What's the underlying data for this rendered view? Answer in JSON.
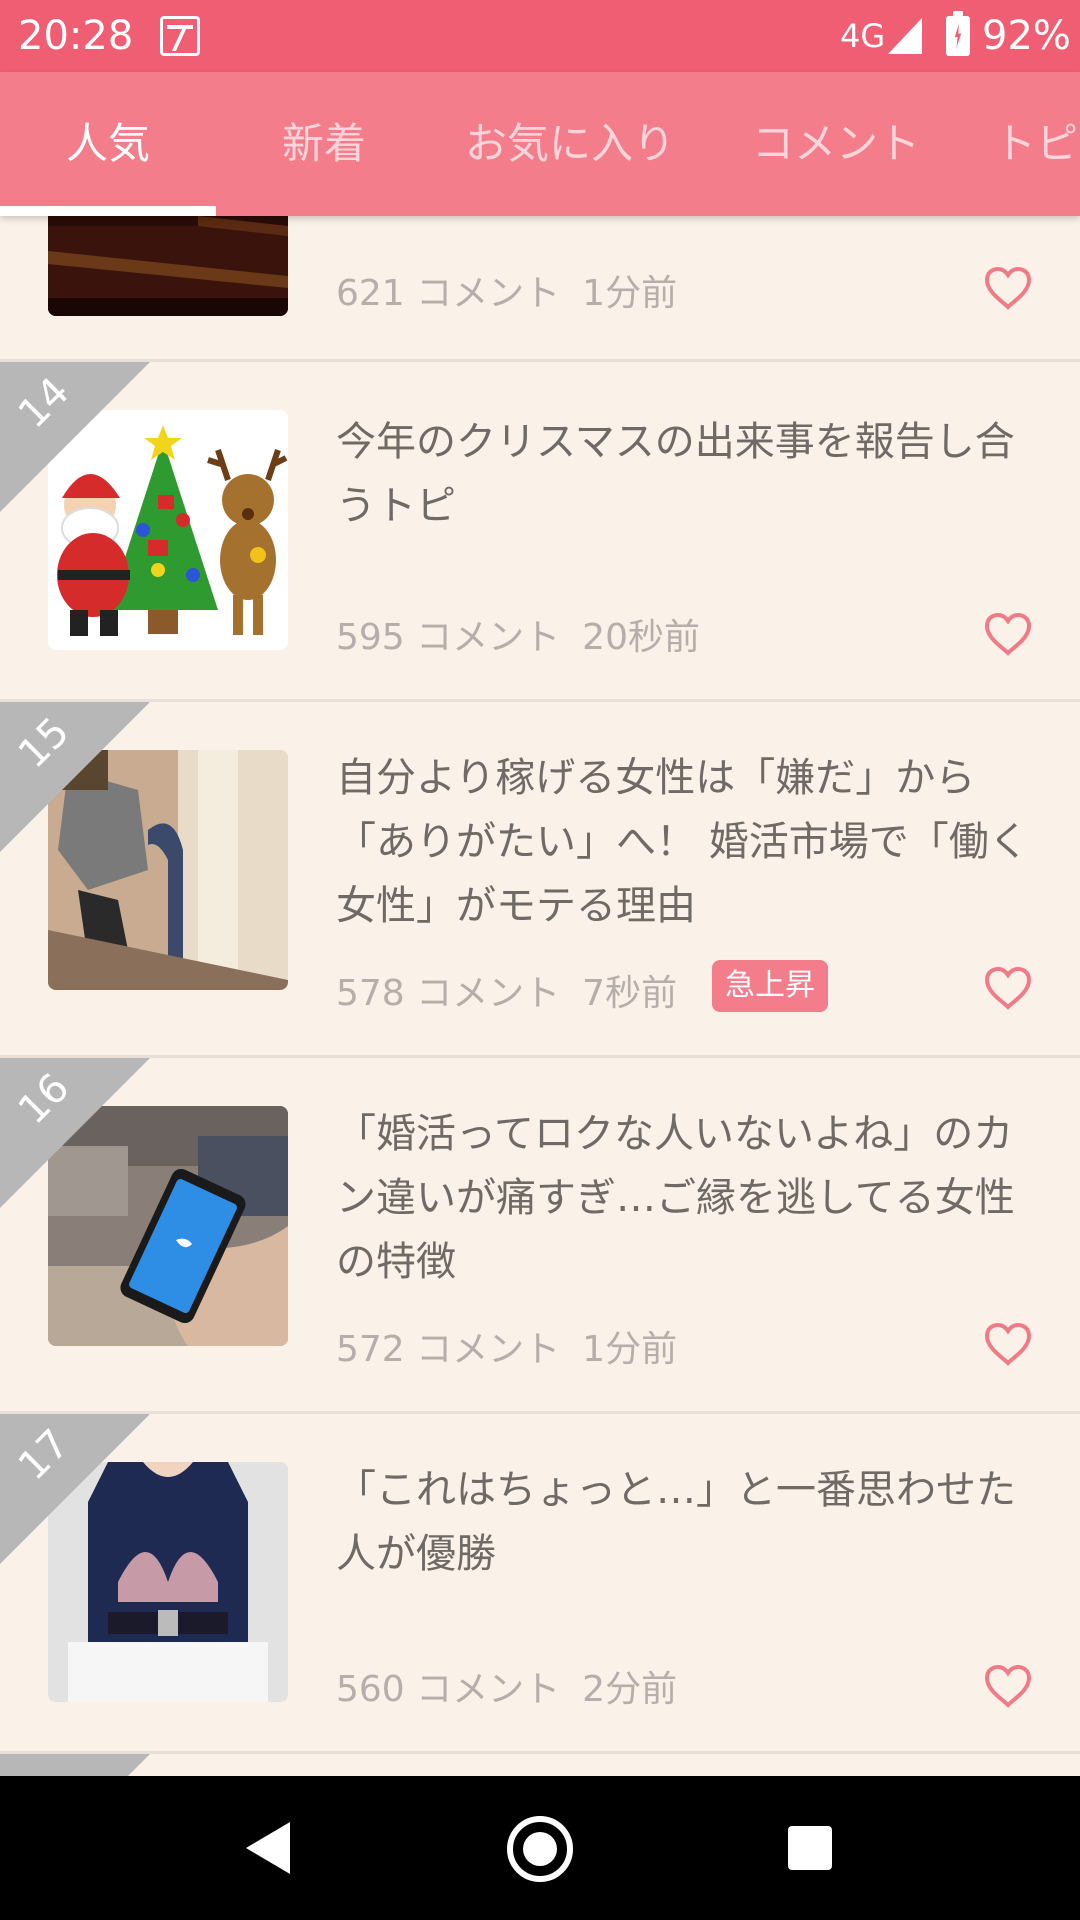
{
  "status_bar": {
    "time": "20:28",
    "network": "4G",
    "battery": "92%",
    "notification_icon": "news-app-icon"
  },
  "tabs": [
    {
      "label": "人気",
      "active": true
    },
    {
      "label": "新着",
      "active": false
    },
    {
      "label": "お気に入り",
      "active": false
    },
    {
      "label": "コメント",
      "active": false
    },
    {
      "label": "トピ",
      "active": false
    }
  ],
  "items": [
    {
      "rank": "",
      "title": "",
      "comments": "621 コメント",
      "time": "1分前",
      "badge": "",
      "thumbnail": "dark-room-photo"
    },
    {
      "rank": "14",
      "title": "今年のクリスマスの出来事を報告し合うトピ",
      "comments": "595 コメント",
      "time": "20秒前",
      "badge": "",
      "thumbnail": "christmas-santa-tree-reindeer-illustration"
    },
    {
      "rank": "15",
      "title": "自分より稼げる女性は「嫌だ」から「ありがたい」へ！ 婚活市場で「働く女性」がモテる理由",
      "comments": "578 コメント",
      "time": "7秒前",
      "badge": "急上昇",
      "thumbnail": "woman-on-escalator-photo"
    },
    {
      "rank": "16",
      "title": "「婚活ってロクな人いないよね」のカン違いが痛すぎ…ご縁を逃してる女性の特徴",
      "comments": "572 コメント",
      "time": "1分前",
      "badge": "",
      "thumbnail": "hand-holding-smartphone-photo"
    },
    {
      "rank": "17",
      "title": "「これはちょっと…」と一番思わせた人が優勝",
      "comments": "560 コメント",
      "time": "2分前",
      "badge": "",
      "thumbnail": "lace-bralette-outfit-photo"
    }
  ],
  "colors": {
    "status_bar": "#ef5e72",
    "tab_bar": "#f47d8b",
    "background": "#f8f0e7",
    "heart": "#f07a86",
    "rank_ribbon": "#b7b7b7",
    "badge": "#f47d8b"
  },
  "nav_bar": {
    "back_icon": "back-triangle-icon",
    "home_icon": "home-circle-icon",
    "recent_icon": "recent-apps-square-icon"
  }
}
